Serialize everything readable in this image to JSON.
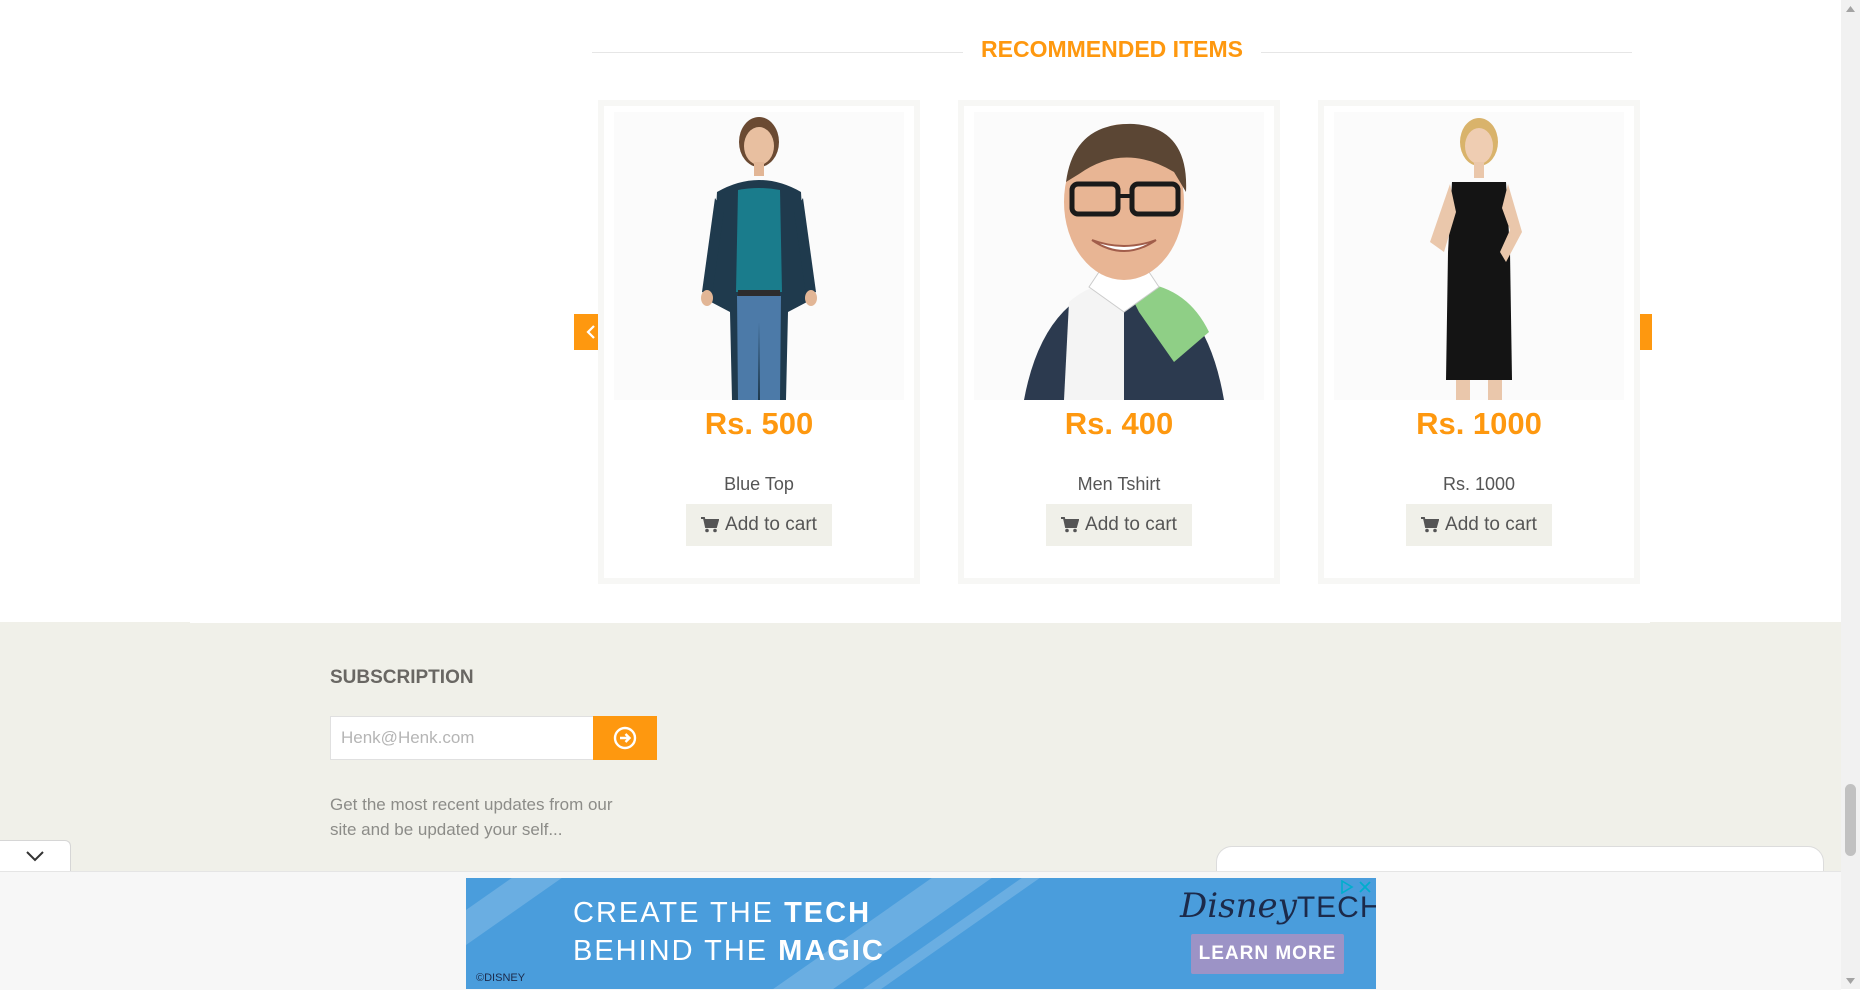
{
  "recommended": {
    "title": "RECOMMENDED ITEMS",
    "items": [
      {
        "price": "Rs. 500",
        "name": "Blue Top",
        "button": "Add to cart"
      },
      {
        "price": "Rs. 400",
        "name": "Men Tshirt",
        "button": "Add to cart"
      },
      {
        "price": "Rs. 1000",
        "name": "Rs. 1000",
        "button": "Add to cart"
      }
    ]
  },
  "subscription": {
    "title": "SUBSCRIPTION",
    "placeholder": "Henk@Henk.com",
    "description": "Get the most recent updates from our site and be updated your self..."
  },
  "ad": {
    "line1_a": "CREATE THE ",
    "line1_b": "TECH",
    "line2_a": "BEHIND THE ",
    "line2_b": "MAGIC",
    "logo_main": "Disney",
    "logo_tech": "TECH",
    "button": "LEARN MORE",
    "copyright": "©DISNEY"
  },
  "colors": {
    "accent": "#FE980F",
    "footer_bg": "#F0F0E9",
    "ad_bg": "#4a9ddc"
  },
  "icons": [
    "chevron-left-icon",
    "chevron-right-icon",
    "cart-icon",
    "arrow-circle-right-icon",
    "chevron-down-icon",
    "ad-info-icon",
    "close-icon"
  ]
}
